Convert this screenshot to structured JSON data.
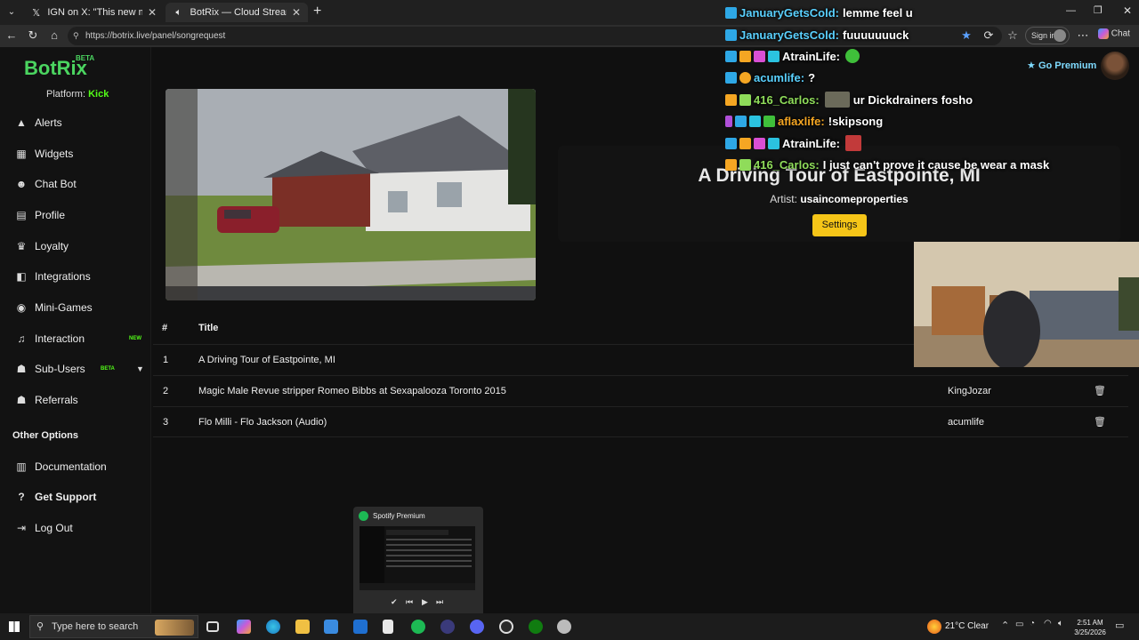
{
  "browser": {
    "tabs": [
      {
        "title": "IGN on X: \"This new martial arts th",
        "icon": "x-logo-icon"
      },
      {
        "title": "BotRix — Cloud Streaming Bo",
        "icon": "speaker-icon"
      }
    ],
    "url": "https://botrix.live/panel/songrequest",
    "sign_in": "Sign in",
    "chat_label": "Chat"
  },
  "app": {
    "logo": "BotRix",
    "logo_badge": "BETA",
    "platform_label": "Platform:",
    "platform_value": "Kick",
    "go_premium": "Go Premium",
    "nav": [
      {
        "label": "Alerts",
        "icon": "warning-icon"
      },
      {
        "label": "Widgets",
        "icon": "grid-icon"
      },
      {
        "label": "Chat Bot",
        "icon": "robot-icon"
      },
      {
        "label": "Profile",
        "icon": "id-card-icon"
      },
      {
        "label": "Loyalty",
        "icon": "trophy-icon"
      },
      {
        "label": "Integrations",
        "icon": "plug-icon"
      },
      {
        "label": "Mini-Games",
        "icon": "gamepad-icon"
      },
      {
        "label": "Interaction",
        "icon": "music-icon",
        "badge": "NEW"
      },
      {
        "label": "Sub-Users",
        "icon": "users-icon",
        "badge": "BETA"
      },
      {
        "label": "Referrals",
        "icon": "user-group-icon"
      }
    ],
    "other_options_title": "Other Options",
    "other_nav": [
      {
        "label": "Documentation",
        "icon": "book-icon"
      },
      {
        "label": "Get Support",
        "icon": "question-icon"
      },
      {
        "label": "Log Out",
        "icon": "logout-icon"
      }
    ]
  },
  "now_playing": {
    "title": "A Driving Tour of Eastpointe, MI",
    "artist_label": "Artist:",
    "artist": "usaincomeproperties",
    "settings_label": "Settings"
  },
  "queue": {
    "headers": [
      "#",
      "Title"
    ],
    "rows": [
      {
        "num": "1",
        "title": "A Driving Tour of Eastpointe, MI",
        "user": ""
      },
      {
        "num": "2",
        "title": "Magic Male Revue stripper Romeo Bibbs at Sexapalooza Toronto 2015",
        "user": "KingJozar"
      },
      {
        "num": "3",
        "title": "Flo Milli - Flo Jackson (Audio)",
        "user": "acumlife"
      }
    ]
  },
  "chat": [
    {
      "user": "JanuaryGetsCold:",
      "msg": "lemme feel u",
      "color": "#5ad1ff"
    },
    {
      "user": "JanuaryGetsCold:",
      "msg": "fuuuuuuuck",
      "color": "#5ad1ff"
    },
    {
      "user": "AtrainLife:",
      "msg": "",
      "color": "#ffffff"
    },
    {
      "user": "acumlife:",
      "msg": "?",
      "color": "#5ad1ff"
    },
    {
      "user": "416_Carlos:",
      "msg": "ur Dickdrainers fosho",
      "color": "#8fdc5a"
    },
    {
      "user": "aflaxlife:",
      "msg": "!skipsong",
      "color": "#f5a623"
    },
    {
      "user": "AtrainLife:",
      "msg": "",
      "color": "#ffffff"
    },
    {
      "user": "416_Carlos:",
      "msg": "I just can't prove it cause be wear a mask",
      "color": "#8fdc5a"
    }
  ],
  "spotify": {
    "title": "Spotify Premium"
  },
  "taskbar": {
    "search_placeholder": "Type here to search",
    "weather": "21°C  Clear",
    "time": "2:51 AM",
    "date": "3/25/2026"
  },
  "colors": {
    "brand": "#4bd560",
    "kick": "#53fc18",
    "settings_button": "#f5c518"
  }
}
